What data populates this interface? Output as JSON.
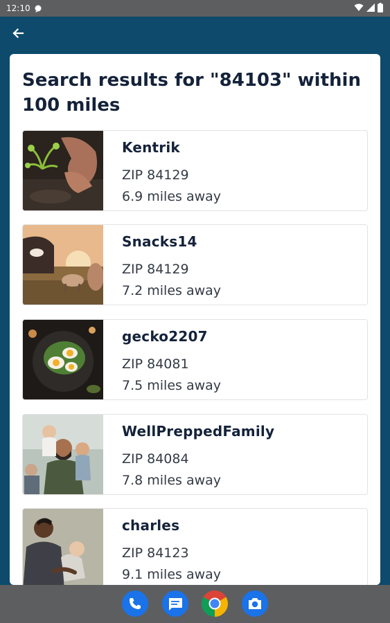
{
  "status_bar": {
    "time": "12:10"
  },
  "search": {
    "heading": "Search results for \"84103\" within 100 miles"
  },
  "results": [
    {
      "name": "Kentrik",
      "zip": "ZIP 84129",
      "distance": "6.9 miles away",
      "photo": "hands-planting-seedling"
    },
    {
      "name": "Snacks14",
      "zip": "ZIP 84129",
      "distance": "7.2 miles away",
      "photo": "farm-animals-at-sunset"
    },
    {
      "name": "gecko2207",
      "zip": "ZIP 84081",
      "distance": "7.5 miles away",
      "photo": "salad-with-eggs"
    },
    {
      "name": "WellPreppedFamily",
      "zip": "ZIP 84084",
      "distance": "7.8 miles away",
      "photo": "family-portrait"
    },
    {
      "name": "charles",
      "zip": "ZIP 84123",
      "distance": "9.1 miles away",
      "photo": "father-with-baby"
    }
  ],
  "dock": [
    "phone-icon",
    "messages-icon",
    "chrome-icon",
    "camera-icon"
  ],
  "colors": {
    "app_bar": "#0d4a6b",
    "system_bars": "#5d5e60",
    "heading_text": "#14223a"
  }
}
